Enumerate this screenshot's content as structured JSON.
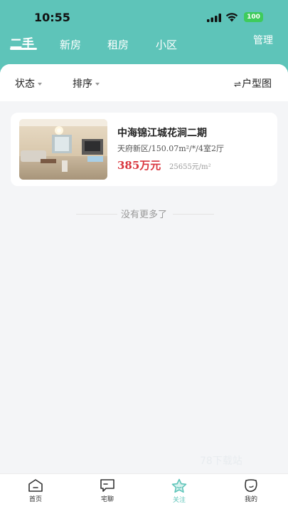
{
  "status_bar": {
    "time": "10:55",
    "battery": "100"
  },
  "tabs": [
    {
      "label": "二手",
      "active": true
    },
    {
      "label": "新房"
    },
    {
      "label": "租房"
    },
    {
      "label": "小区"
    }
  ],
  "header": {
    "manage_label": "管理"
  },
  "filters": {
    "status": "状态",
    "sort": "排序",
    "layout": "户型图"
  },
  "listing": {
    "title": "中海锦江城花涧二期",
    "info": "天府新区/150.07m²/*/4室2厅",
    "price": "385万元",
    "unit_price": "25655元/m²"
  },
  "end_message": "没有更多了",
  "watermark": "78下载站",
  "bottom_nav": [
    {
      "label": "首页",
      "icon": "home-icon"
    },
    {
      "label": "宅聊",
      "icon": "chat-icon"
    },
    {
      "label": "关注",
      "icon": "star-icon",
      "active": true
    },
    {
      "label": "我的",
      "icon": "profile-icon"
    }
  ],
  "colors": {
    "accent": "#5ec4b9",
    "price": "#d9363e"
  }
}
